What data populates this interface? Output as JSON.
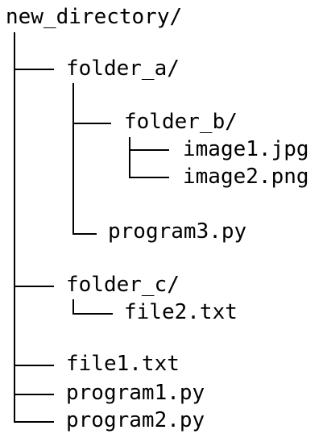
{
  "root": {
    "label": "new_directory/"
  },
  "folder_a": {
    "label": "folder_a/",
    "folder_b": {
      "label": "folder_b/",
      "files": [
        "image1.jpg",
        "image2.png"
      ]
    },
    "file": "program3.py"
  },
  "folder_c": {
    "label": "folder_c/",
    "files": [
      "file2.txt"
    ]
  },
  "root_files": [
    "file1.txt",
    "program1.py",
    "program2.py"
  ],
  "colors": {
    "text": "#000000",
    "background": "#ffffff"
  }
}
